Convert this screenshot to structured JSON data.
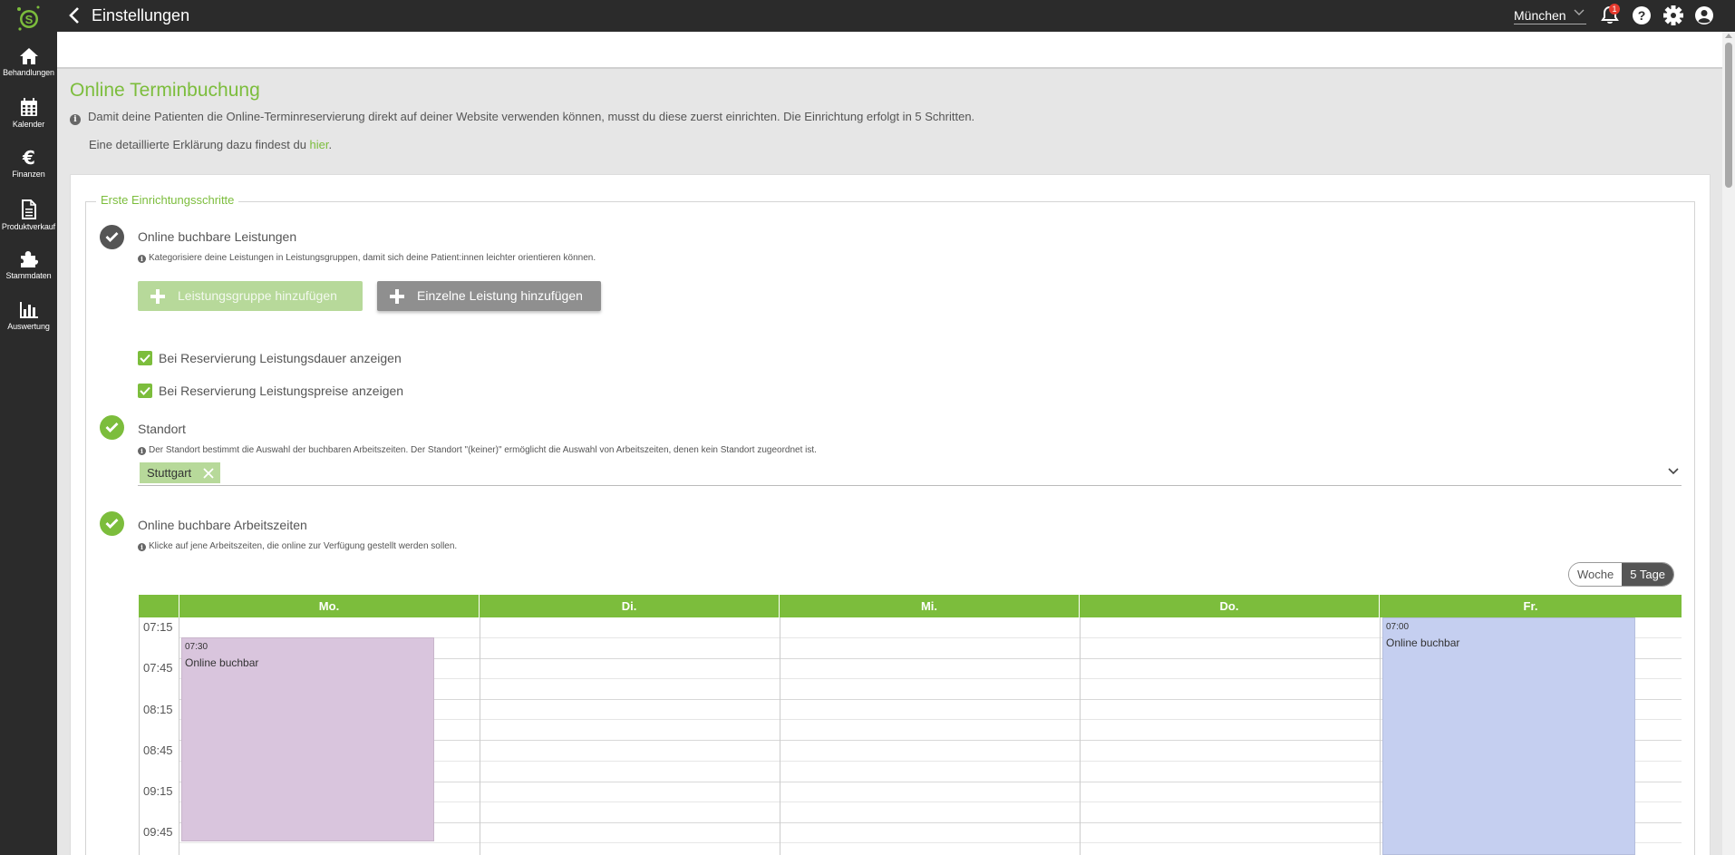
{
  "sidebar": {
    "items": [
      {
        "label": "Behandlungen",
        "icon": "home-icon"
      },
      {
        "label": "Kalender",
        "icon": "calendar-icon"
      },
      {
        "label": "Finanzen",
        "icon": "euro-icon"
      },
      {
        "label": "Produktverkauf",
        "icon": "document-icon"
      },
      {
        "label": "Stammdaten",
        "icon": "puzzle-icon"
      },
      {
        "label": "Auswertung",
        "icon": "bar-chart-icon"
      }
    ]
  },
  "topbar": {
    "title": "Einstellungen",
    "location": "München",
    "notification_count": "1"
  },
  "page": {
    "title": "Online Terminbuchung",
    "intro": "Damit deine Patienten die Online-Terminreservierung direkt auf deiner Website verwenden können, musst du diese zuerst einrichten. Die Einrichtung erfolgt in 5 Schritten.",
    "help_prefix": "Eine detaillierte Erklärung dazu findest du ",
    "help_link": "hier",
    "help_suffix": "."
  },
  "setup": {
    "legend": "Erste Einrichtungsschritte",
    "step1": {
      "title": "Online buchbare Leistungen",
      "hint": "Kategorisiere deine Leistungen in Leistungsgruppen, damit sich deine Patient:innen leichter orientieren können.",
      "add_group_label": "Leistungsgruppe hinzufügen",
      "add_single_label": "Einzelne Leistung hinzufügen"
    },
    "checkbox_duration": "Bei Reservierung Leistungsdauer anzeigen",
    "checkbox_price": "Bei Reservierung Leistungspreise anzeigen",
    "step2": {
      "title": "Standort",
      "hint": "Der Standort bestimmt die Auswahl der buchbaren Arbeitszeiten. Der Standort \"(keiner)\" ermöglicht die Auswahl von Arbeitszeiten, denen kein Standort zugeordnet ist.",
      "selected_tag": "Stuttgart"
    },
    "step3": {
      "title": "Online buchbare Arbeitszeiten",
      "hint": "Klicke auf jene Arbeitszeiten, die online zur Verfügung gestellt werden sollen."
    }
  },
  "view_toggle": {
    "options": [
      "Woche",
      "5 Tage"
    ],
    "active": "5 Tage"
  },
  "calendar": {
    "days": [
      "Mo.",
      "Di.",
      "Mi.",
      "Do.",
      "Fr."
    ],
    "times": [
      "07:15",
      "07:45",
      "08:15",
      "08:45",
      "09:15",
      "09:45"
    ],
    "events": [
      {
        "day": "Mo.",
        "start": "07:30",
        "label": "Online buchbar",
        "color": "#d9c5dd"
      },
      {
        "day": "Fr.",
        "start": "07:00",
        "label": "Online buchbar",
        "color": "#c5cff0"
      }
    ]
  },
  "colors": {
    "accent": "#7cbd3c",
    "sidebar_bg": "#2b2b2b",
    "notification": "#e63a2e"
  }
}
